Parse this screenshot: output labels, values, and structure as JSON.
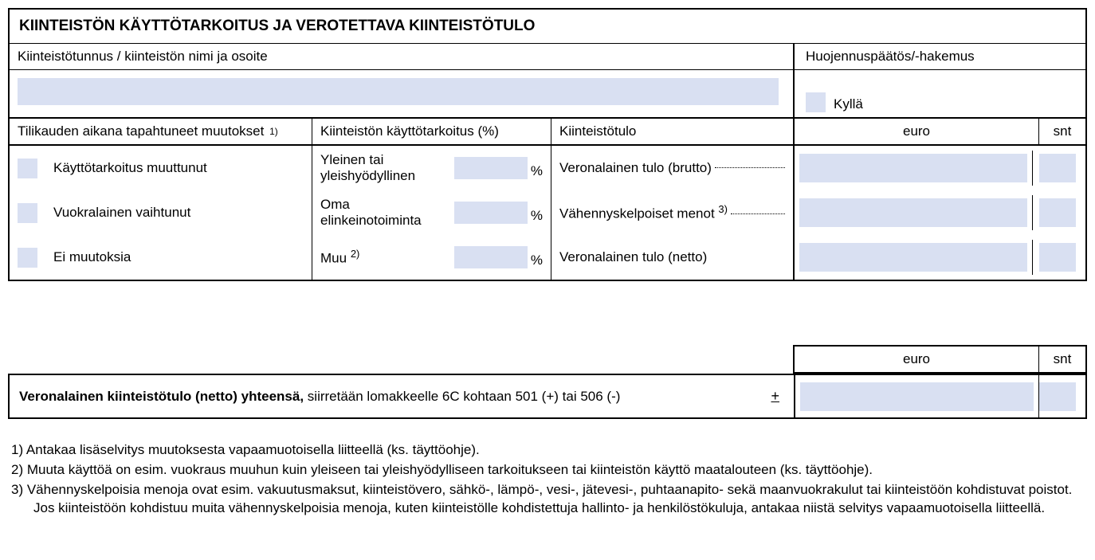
{
  "title": "KIINTEISTÖN KÄYTTÖTARKOITUS JA VEROTETTAVA KIINTEISTÖTULO",
  "header": {
    "prop_id_label": "Kiinteistötunnus / kiinteistön nimi ja osoite",
    "relief_label": "Huojennuspäätös/-hakemus",
    "yes_label": "Kyllä"
  },
  "columns": {
    "changes_label": "Tilikauden aikana tapahtuneet muutokset",
    "changes_sup": "1)",
    "usage_label": "Kiinteistön käyttötarkoitus (%)",
    "income_label": "Kiinteistötulo",
    "euro": "euro",
    "snt": "snt"
  },
  "changes": {
    "opt1": "Käyttötarkoitus muuttunut",
    "opt2": "Vuokralainen vaihtunut",
    "opt3": "Ei muutoksia"
  },
  "usage": {
    "row1": "Yleinen tai yleishyödyllinen",
    "row2": "Oma elinkeinotoiminta",
    "row3_label": "Muu",
    "row3_sup": "2)",
    "pct": "%"
  },
  "income": {
    "row1": "Veronalainen tulo (brutto)",
    "row2": "Vähennyskelpoiset menot",
    "row2_sup": "3)",
    "row3": "Veronalainen tulo (netto)"
  },
  "totals": {
    "bold": "Veronalainen kiinteistötulo (netto) yhteensä,",
    "rest": " siirretään lomakkeelle 6C kohtaan 501 (+) tai 506 (-)",
    "pm": "+"
  },
  "footnotes": {
    "f1": "1) Antakaa lisäselvitys muutoksesta vapaamuotoisella liitteellä (ks. täyttöohje).",
    "f2": "2) Muuta käyttöä on esim. vuokraus muuhun kuin yleiseen tai yleishyödylliseen tarkoitukseen tai kiinteistön käyttö maatalouteen (ks. täyttöohje).",
    "f3": "3) Vähennyskelpoisia menoja ovat esim. vakuutusmaksut, kiinteistövero, sähkö-, lämpö-, vesi-, jätevesi-, puhtaanapito- sekä maanvuokrakulut tai kiinteistöön kohdistuvat poistot. Jos kiinteistöön kohdistuu muita vähennyskelpoisia menoja, kuten kiinteistölle kohdistettuja hallinto- ja henkilöstökuluja, antakaa niistä selvitys vapaamuotoisella liitteellä."
  }
}
